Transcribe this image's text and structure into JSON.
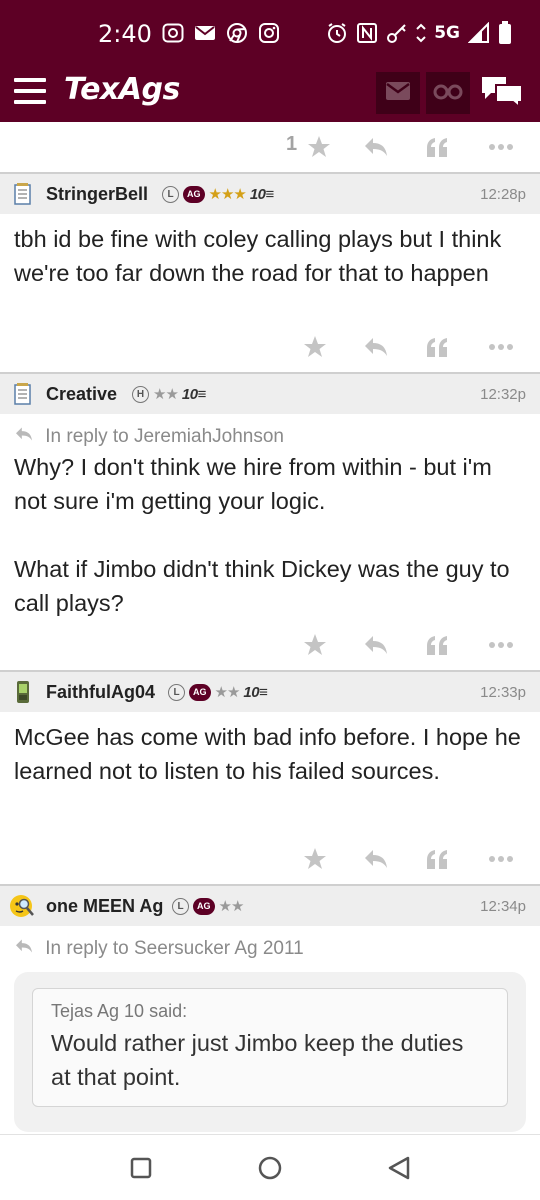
{
  "status_bar": {
    "time": "2:40",
    "network": "5G",
    "left_icons": [
      "bbm-icon",
      "mail-icon",
      "chrome-icon",
      "instagram-icon"
    ],
    "right_icons": [
      "alarm-icon",
      "nfc-icon",
      "vpn-key-icon",
      "data-arrows-icon",
      "signal-icon",
      "battery-icon"
    ]
  },
  "app_header": {
    "brand": "TexAgs",
    "background": "#5d0025",
    "icons": [
      "menu-icon",
      "mail-icon",
      "binoculars-icon",
      "chat-icon"
    ]
  },
  "top_actions": {
    "star_count": "1"
  },
  "posts": [
    {
      "username": "StringerBell",
      "user_icon": "notepad-icon",
      "badge_circle": "L",
      "badge_ag": "AG",
      "stars": "★★★",
      "stars_color": "gold",
      "ten": "10",
      "time": "12:28p",
      "body": [
        "tbh id be fine with coley calling plays but I think we're too far down the road for that to happen"
      ]
    },
    {
      "username": "Creative",
      "user_icon": "notepad-icon",
      "badge_circle": "H",
      "stars": "★★",
      "ten": "10",
      "time": "12:32p",
      "reply_to": "In reply to JeremiahJohnson",
      "body": [
        "Why? I don't think we hire from within - but i'm not sure i'm getting your logic.",
        "What if Jimbo didn't think Dickey was the guy to call plays?"
      ]
    },
    {
      "username": "FaithfulAg04",
      "user_icon": "phone-icon",
      "badge_circle": "L",
      "badge_ag": "AG",
      "stars": "★★",
      "ten": "10",
      "time": "12:33p",
      "body": [
        "McGee has come with bad info before. I hope he learned not to listen to his failed sources."
      ]
    },
    {
      "username": "one MEEN Ag",
      "user_icon": "detective-emoji-icon",
      "badge_circle": "L",
      "badge_ag": "AG",
      "stars": "★★",
      "time": "12:34p",
      "reply_to": "In reply to Seersucker Ag 2011",
      "quote": {
        "author": "Tejas Ag 10 said:",
        "text": "Would rather just Jimbo keep the duties at that point."
      }
    }
  ],
  "nav_bar": {
    "buttons": [
      "recent-apps-icon",
      "home-icon",
      "back-icon"
    ]
  }
}
